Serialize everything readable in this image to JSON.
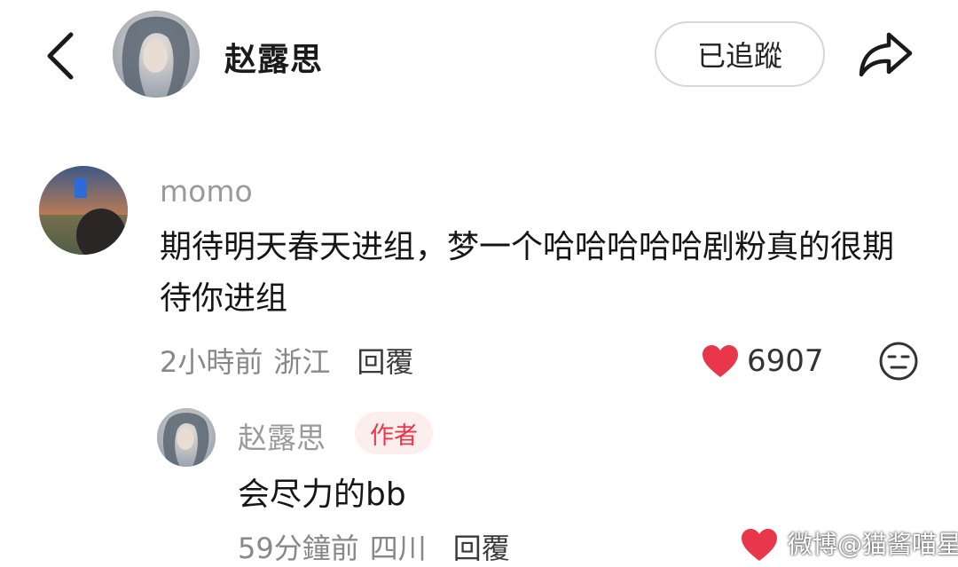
{
  "header": {
    "username": "赵露思",
    "follow_label": "已追蹤",
    "back_icon": "chevron-left-icon",
    "share_icon": "share-arrow-icon"
  },
  "comment": {
    "username": "momo",
    "text": "期待明天春天进组，梦一个哈哈哈哈哈剧粉真的很期待你进组",
    "time": "2小時前",
    "location": "浙江",
    "reply_label": "回覆",
    "like_count": "6907",
    "like_color": "#e8374a"
  },
  "reply": {
    "username": "赵露思",
    "author_badge": "作者",
    "text": "会尽力的bb",
    "time": "59分鐘前",
    "location": "四川",
    "reply_label": "回覆"
  },
  "watermark": {
    "text": "微博@猫酱喵星"
  }
}
